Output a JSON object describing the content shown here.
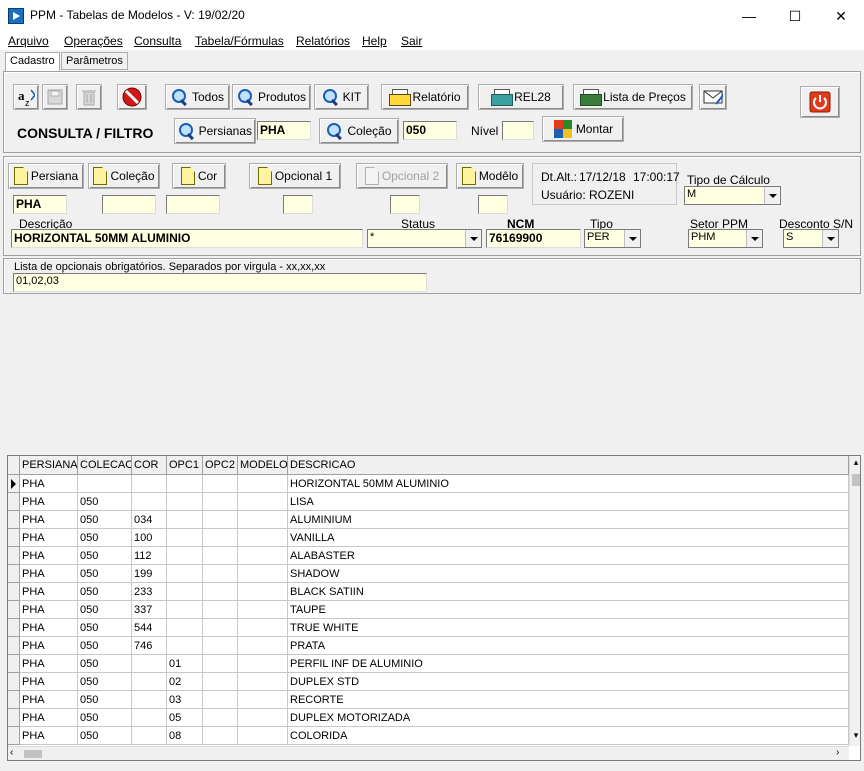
{
  "window": {
    "title": "PPM - Tabelas de Modelos - V: 19/02/20",
    "minimize": "—",
    "maximize": "☐",
    "close": "✕"
  },
  "menu": [
    "Arquivo",
    "Operações",
    "Consulta",
    "Tabela/Fórmulas",
    "Relatórios",
    "Help",
    "Sair"
  ],
  "tabs": [
    "Cadastro",
    "Parâmetros"
  ],
  "toolbar": {
    "todos": "Todos",
    "produtos": "Produtos",
    "kit": "KIT",
    "relatorio": "Relatório",
    "rel28": "REL28",
    "lista_precos": "Lista de Preços",
    "consulta_filtro": "CONSULTA / FILTRO",
    "persianas": "Persianas",
    "persianas_value": "PHA",
    "colecao": "Coleção",
    "colecao_value": "050",
    "nivel": "Nível",
    "nivel_value": "",
    "montar": "Montar"
  },
  "form": {
    "persiana_btn": "Persiana",
    "colecao_btn": "Coleção",
    "cor_btn": "Cor",
    "opcional1_btn": "Opcional 1",
    "opcional2_btn": "Opcional 2",
    "modelo_btn": "Modêlo",
    "persiana_value": "PHA",
    "colecao_value": "",
    "cor_value": "",
    "opcional1_value": "",
    "opcional2_value": "",
    "modelo_value": "",
    "dt_alt_label": "Dt.Alt.:",
    "dt_alt_value": "17/12/18",
    "time_value": "17:00:17",
    "usuario_label": "Usuário:",
    "usuario_value": "ROZENI",
    "tipo_calculo_label": "Tipo de Cálculo",
    "tipo_calculo_value": "M",
    "descricao_label": "Descrição",
    "descricao_value": "HORIZONTAL 50MM ALUMINIO",
    "status_label": "Status",
    "status_value": "*",
    "ncm_label": "NCM",
    "ncm_value": "76169900",
    "tipo_label": "Tipo",
    "tipo_value": "PER",
    "setor_label": "Setor  PPM",
    "setor_value": "PHM",
    "desconto_label": "Desconto S/N",
    "desconto_value": "S",
    "opcionais_label": "Lista de opcionais obrigatórios. Separados por virgula - xx,xx,xx",
    "opcionais_value": "01,02,03"
  },
  "grid": {
    "columns": [
      "PERSIANA",
      "COLECAO",
      "COR",
      "OPC1",
      "OPC2",
      "MODELO",
      "DESCRICAO"
    ],
    "rows": [
      [
        "PHA",
        "",
        "",
        "",
        "",
        "",
        "HORIZONTAL 50MM ALUMINIO"
      ],
      [
        "PHA",
        "050",
        "",
        "",
        "",
        "",
        "LISA"
      ],
      [
        "PHA",
        "050",
        "034",
        "",
        "",
        "",
        "ALUMINIUM"
      ],
      [
        "PHA",
        "050",
        "100",
        "",
        "",
        "",
        "VANILLA"
      ],
      [
        "PHA",
        "050",
        "112",
        "",
        "",
        "",
        "ALABASTER"
      ],
      [
        "PHA",
        "050",
        "199",
        "",
        "",
        "",
        "SHADOW"
      ],
      [
        "PHA",
        "050",
        "233",
        "",
        "",
        "",
        "BLACK SATIIN"
      ],
      [
        "PHA",
        "050",
        "337",
        "",
        "",
        "",
        "TAUPE"
      ],
      [
        "PHA",
        "050",
        "544",
        "",
        "",
        "",
        "TRUE WHITE"
      ],
      [
        "PHA",
        "050",
        "746",
        "",
        "",
        "",
        "PRATA"
      ],
      [
        "PHA",
        "050",
        "",
        "01",
        "",
        "",
        "PERFIL INF DE ALUMINIO"
      ],
      [
        "PHA",
        "050",
        "",
        "02",
        "",
        "",
        "DUPLEX STD"
      ],
      [
        "PHA",
        "050",
        "",
        "03",
        "",
        "",
        "RECORTE"
      ],
      [
        "PHA",
        "050",
        "",
        "05",
        "",
        "",
        "DUPLEX MOTORIZADA"
      ],
      [
        "PHA",
        "050",
        "",
        "08",
        "",
        "",
        "COLORIDA"
      ]
    ]
  }
}
